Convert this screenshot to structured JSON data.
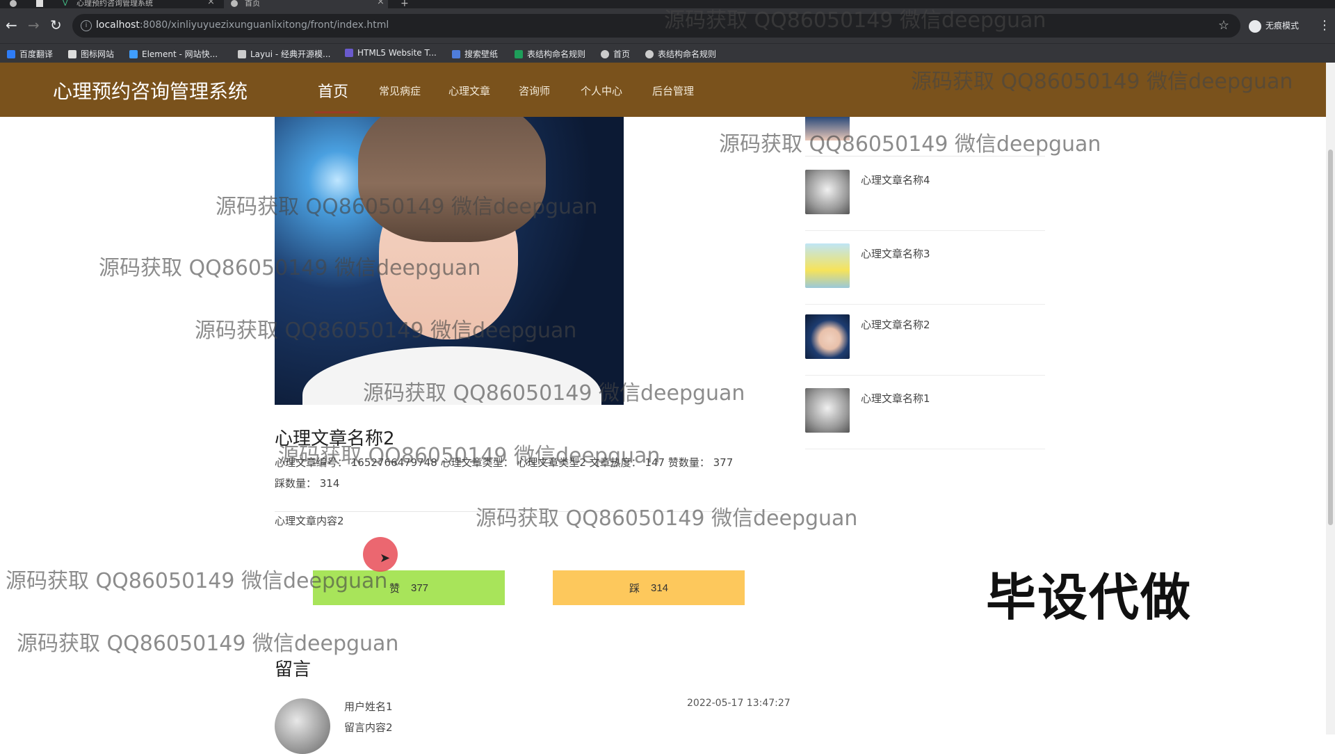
{
  "browser": {
    "tabs": [
      {
        "label": "心理预约咨询管理系统",
        "active": false
      },
      {
        "label": "首页",
        "active": true
      }
    ],
    "url_host": "localhost",
    "url_rest": ":8080/xinliyuyuezixunguanlixitong/front/index.html",
    "incognito_label": "无痕模式",
    "bookmarks": [
      "百度翻译",
      "图标网站",
      "Element - 网站快...",
      "Layui - 经典开源模...",
      "HTML5 Website T...",
      "搜索壁纸",
      "表结构命名规则",
      "首页",
      "表结构命名规则"
    ]
  },
  "header": {
    "title": "心理预约咨询管理系统",
    "nav": [
      "首页",
      "常见病症",
      "心理文章",
      "咨询师",
      "个人中心",
      "后台管理"
    ],
    "active_nav": "首页",
    "bg_color": "#7a521c"
  },
  "article": {
    "title": "心理文章名称2",
    "meta_line1": "心理文章编号： 1652766479748    心理文章类型： 心理文章类型2    文章热度： 147    赞数量： 377",
    "meta_line2": "踩数量： 314",
    "content": "心理文章内容2",
    "like_label": "赞",
    "like_count": "377",
    "dislike_label": "踩",
    "dislike_count": "314"
  },
  "comments": {
    "heading": "留言",
    "items": [
      {
        "user": "用户姓名1",
        "content": "留言内容2",
        "time": "2022-05-17 13:47:27"
      }
    ]
  },
  "sidebar": {
    "items": [
      {
        "title": "心理文章名称4"
      },
      {
        "title": "心理文章名称3"
      },
      {
        "title": "心理文章名称2"
      },
      {
        "title": "心理文章名称1"
      }
    ]
  },
  "overlay": {
    "watermark": "源码获取 QQ86050149 微信deepguan",
    "stamp": "毕设代做"
  }
}
